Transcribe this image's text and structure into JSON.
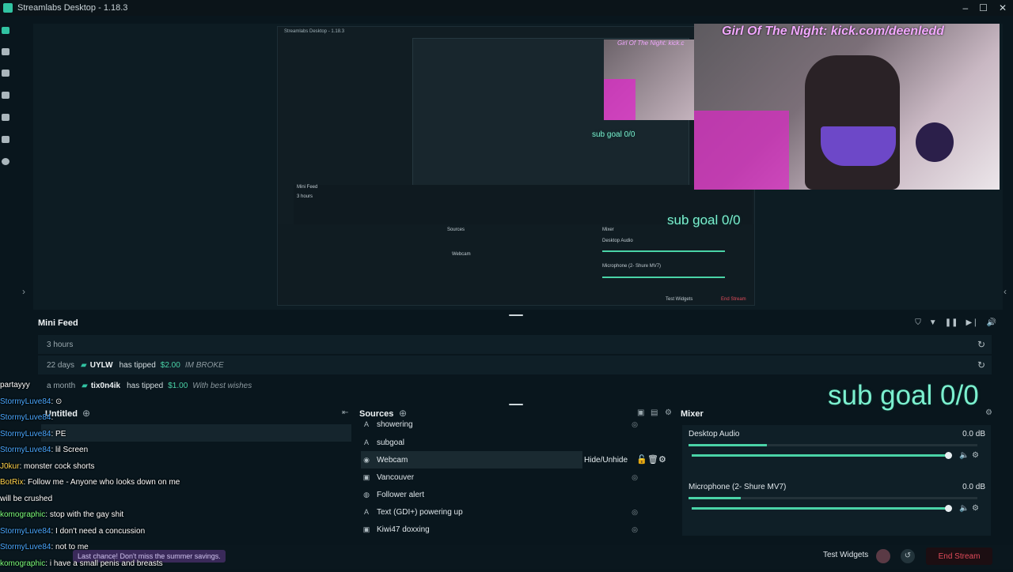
{
  "app": {
    "title": "Streamlabs Desktop - 1.18.3"
  },
  "colors": {
    "accent": "#4ad3a7",
    "danger": "#e24b5a",
    "background": "#09161d"
  },
  "stream_overlay": {
    "camera_banner": "Girl Of The Night: kick.com/deenledd",
    "inner_banner": "Girl Of The Night: kick.c",
    "sub_goal_large": "sub goal 0/0",
    "sub_goal_mid": "sub goal 0/0",
    "sub_goal_small": "sub goal 0/0"
  },
  "mini_feed": {
    "title": "Mini Feed",
    "rows": [
      {
        "ago": "3 hours",
        "name": "",
        "action": "",
        "amount": "",
        "message": ""
      },
      {
        "ago": "22 days",
        "name": "UYLW",
        "action": "has tipped",
        "amount": "$2.00",
        "message": "IM BROKE"
      },
      {
        "ago": "a month",
        "name": "tix0n4ik",
        "action": "has tipped",
        "amount": "$1.00",
        "message": "With best wishes"
      }
    ]
  },
  "scenes": {
    "title": "Untitled"
  },
  "sources": {
    "title": "Sources",
    "items": [
      {
        "icon": "text-icon",
        "label": "showering"
      },
      {
        "icon": "text-icon",
        "label": "subgoal"
      },
      {
        "icon": "webcam-icon",
        "label": "Webcam"
      },
      {
        "icon": "image-icon",
        "label": "Vancouver"
      },
      {
        "icon": "globe-icon",
        "label": "Follower alert"
      },
      {
        "icon": "text-icon",
        "label": "Text (GDI+) powering up"
      },
      {
        "icon": "image-icon",
        "label": "Kiwi47 doxxing"
      }
    ],
    "hover_label": "Hide/Unhide"
  },
  "mixer": {
    "title": "Mixer",
    "channels": [
      {
        "name": "Desktop Audio",
        "db": "0.0 dB",
        "level": 0.27
      },
      {
        "name": "Microphone (2- Shure MV7)",
        "db": "0.0 dB",
        "level": 0.18
      }
    ]
  },
  "chat": {
    "lines": [
      {
        "user": "partayyy",
        "color": "white",
        "text": ""
      },
      {
        "user": "StormyLuve84",
        "color": "blue",
        "text": ": ⊙"
      },
      {
        "user": "StormyLuve84",
        "color": "blue",
        "text": ":"
      },
      {
        "user": "StormyLuve84",
        "color": "blue",
        "text": ": PE"
      },
      {
        "user": "StormyLuve84",
        "color": "blue",
        "text": ": lil Screen"
      },
      {
        "user": "J0kur",
        "color": "yellow",
        "text": ": monster cock shorts"
      },
      {
        "user": "BotRix",
        "color": "yellow",
        "text": ": Follow me - Anyone who looks down on me"
      },
      {
        "user": "",
        "color": "white",
        "text": "will be crushed"
      },
      {
        "user": "komographic",
        "color": "green",
        "text": ": stop with the gay shit"
      },
      {
        "user": "StormyLuve84",
        "color": "blue",
        "text": ": I don't need a concussion"
      },
      {
        "user": "StormyLuve84",
        "color": "blue",
        "text": ": not to me"
      },
      {
        "user": "komographic",
        "color": "green",
        "text": ": i have a small penis and breasts"
      }
    ]
  },
  "footer": {
    "promo": "Last chance! Don't miss the summer savings.",
    "test_widgets": "Test Widgets",
    "end_stream": "End Stream"
  }
}
